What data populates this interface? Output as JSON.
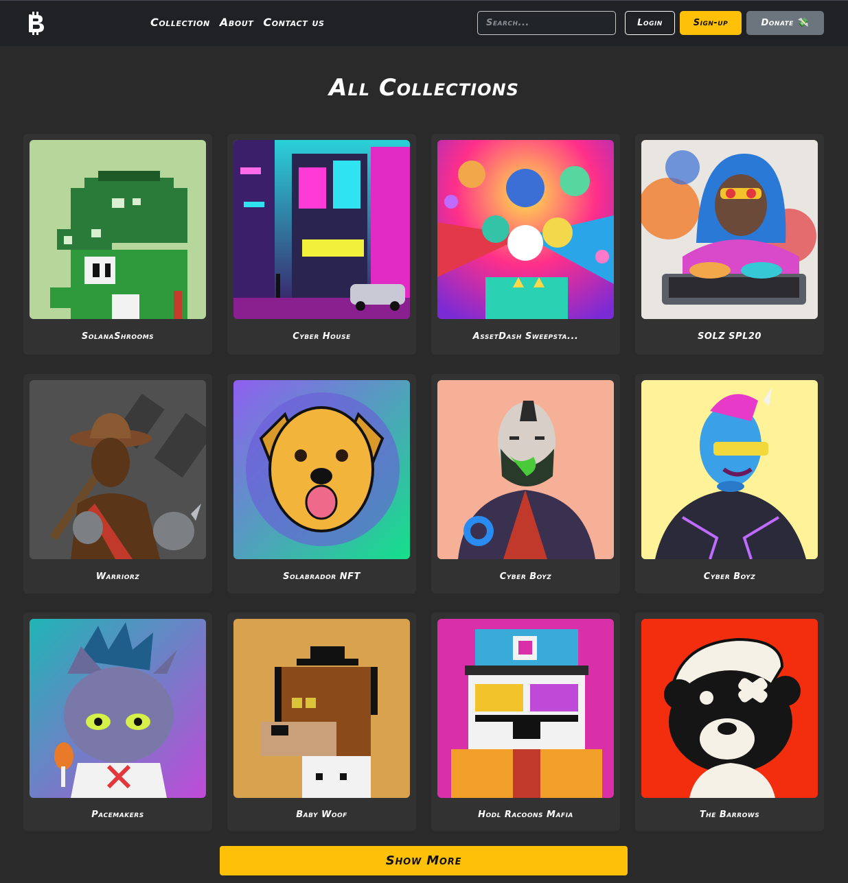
{
  "nav": {
    "links": [
      "Collection",
      "About",
      "Contact us"
    ],
    "search_placeholder": "Search...",
    "login": "Login",
    "signup": "Sign-up",
    "donate": "Donate",
    "donate_icon": "💸"
  },
  "page_title": "All Collections",
  "collections": [
    {
      "title": "SolanaShrooms",
      "image": "pixel-mushroom-dino"
    },
    {
      "title": "Cyber House",
      "image": "neon-cyberpunk-building"
    },
    {
      "title": "AssetDash Sweepsta...",
      "image": "colorful-character-collage"
    },
    {
      "title": "SOLZ SPL20",
      "image": "hooded-graffiti-artist"
    },
    {
      "title": "Warriorz",
      "image": "warrior-with-hammer"
    },
    {
      "title": "Solabrador NFT",
      "image": "pixel-golden-dog"
    },
    {
      "title": "Cyber Boyz",
      "image": "masked-cyber-man"
    },
    {
      "title": "Cyber Boyz",
      "image": "blue-cyber-unicorn"
    },
    {
      "title": "Pacemakers",
      "image": "cartoon-cat-punk"
    },
    {
      "title": "Baby Woof",
      "image": "pixel-dog-with-hat"
    },
    {
      "title": "Hodl Racoons Mafia",
      "image": "pixel-raccoon-cap"
    },
    {
      "title": "The Barrows",
      "image": "bear-with-cap"
    }
  ],
  "show_more": "Show More",
  "colors": {
    "accent": "#ffc107",
    "nav_bg": "#1f2125",
    "page_bg": "#2a2a2a",
    "card_bg": "#323232"
  }
}
